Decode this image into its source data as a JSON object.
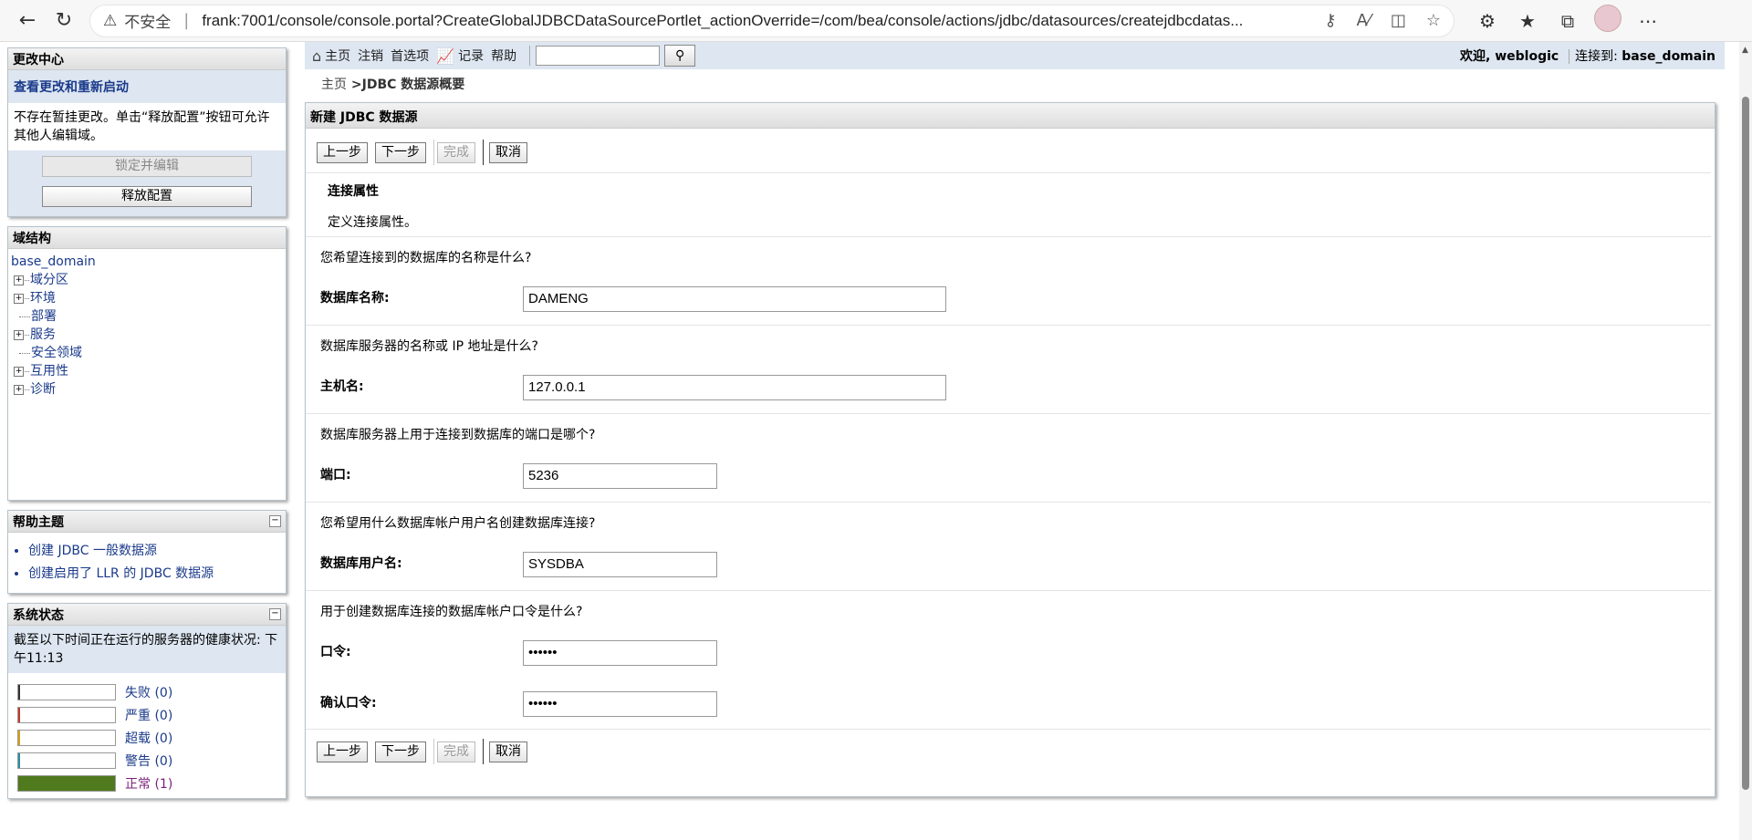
{
  "browser": {
    "insecure_label": "不安全",
    "url": "frank:7001/console/console.portal?CreateGlobalJDBCDataSourcePortlet_actionOverride=/com/bea/console/actions/jdbc/datasources/createjdbcdatas..."
  },
  "change_center": {
    "title": "更改中心",
    "link": "查看更改和重新启动",
    "text": "不存在暂挂更改。单击“释放配置”按钮可允许其他人编辑域。",
    "lock_button": "锁定并编辑",
    "release_button": "释放配置"
  },
  "domain_structure": {
    "title": "域结构",
    "root": "base_domain",
    "items": [
      {
        "label": "域分区",
        "expandable": true
      },
      {
        "label": "环境",
        "expandable": true
      },
      {
        "label": "部署",
        "expandable": false
      },
      {
        "label": "服务",
        "expandable": true
      },
      {
        "label": "安全领域",
        "expandable": false
      },
      {
        "label": "互用性",
        "expandable": true
      },
      {
        "label": "诊断",
        "expandable": true
      }
    ]
  },
  "help": {
    "title": "帮助主题",
    "items": [
      "创建 JDBC 一般数据源",
      "创建启用了 LLR 的 JDBC 数据源"
    ]
  },
  "system_status": {
    "title": "系统状态",
    "desc": "截至以下时间正在运行的服务器的健康状况:  下午11:13",
    "rows": [
      {
        "label": "失败 (0)",
        "color": "#333333",
        "fill": 0
      },
      {
        "label": "严重 (0)",
        "color": "#c0392b",
        "fill": 0
      },
      {
        "label": "超载 (0)",
        "color": "#d4a017",
        "fill": 0
      },
      {
        "label": "警告 (0)",
        "color": "#2a8fa0",
        "fill": 0
      },
      {
        "label": "正常 (1)",
        "color": "#4f7a1e",
        "fill": 1
      }
    ]
  },
  "topbar": {
    "home": "主页",
    "logout": "注销",
    "prefs": "首选项",
    "record": "记录",
    "help": "帮助",
    "welcome_label": "欢迎, ",
    "user": "weblogic",
    "connected_label": "连接到: ",
    "domain": "base_domain"
  },
  "breadcrumb": {
    "home": "主页",
    "separator": " >",
    "current": "JDBC 数据源概要"
  },
  "form": {
    "title": "新建 JDBC 数据源",
    "buttons": {
      "back": "上一步",
      "next": "下一步",
      "finish": "完成",
      "cancel": "取消"
    },
    "section_title": "连接属性",
    "section_desc": "定义连接属性。",
    "q_dbname": "您希望连接到的数据库的名称是什么?",
    "l_dbname": "数据库名称:",
    "v_dbname": "DAMENG",
    "q_host": "数据库服务器的名称或 IP 地址是什么?",
    "l_host": "主机名:",
    "v_host": "127.0.0.1",
    "q_port": "数据库服务器上用于连接到数据库的端口是哪个?",
    "l_port": "端口:",
    "v_port": "5236",
    "q_user": "您希望用什么数据库帐户用户名创建数据库连接?",
    "l_user": "数据库用户名:",
    "v_user": "SYSDBA",
    "q_pass": "用于创建数据库连接的数据库帐户口令是什么?",
    "l_pass": "口令:",
    "v_pass": "••••••",
    "l_confirm": "确认口令:",
    "v_confirm": "••••••"
  }
}
